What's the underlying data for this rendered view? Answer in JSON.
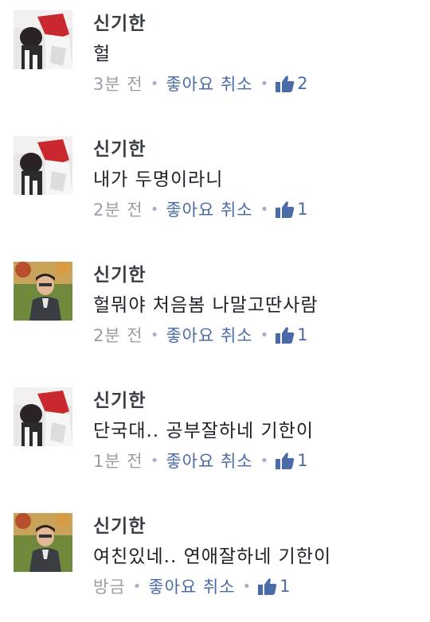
{
  "comments": [
    {
      "avatar": "photo-a",
      "name": "신기한",
      "text": "헐",
      "time": "3분 전",
      "action": "좋아요 취소",
      "likes": "2"
    },
    {
      "avatar": "photo-a",
      "name": "신기한",
      "text": "내가 두명이라니",
      "time": "2분 전",
      "action": "좋아요 취소",
      "likes": "1"
    },
    {
      "avatar": "photo-b",
      "name": "신기한",
      "text": "헐뭐야 처음봄 나말고딴사람",
      "time": "2분 전",
      "action": "좋아요 취소",
      "likes": "1"
    },
    {
      "avatar": "photo-a",
      "name": "신기한",
      "text": "단국대.. 공부잘하네 기한이",
      "time": "1분 전",
      "action": "좋아요 취소",
      "likes": "1"
    },
    {
      "avatar": "photo-b",
      "name": "신기한",
      "text": "여친있네.. 연애잘하네 기한이",
      "time": "방금",
      "action": "좋아요 취소",
      "likes": "1"
    }
  ],
  "separator": "•",
  "icons": {
    "like": "thumbs-up-icon"
  },
  "colors": {
    "link": "#4a6aa8",
    "name": "#3b3f46",
    "meta": "#9a9ea5",
    "dot": "#a7b1c7"
  }
}
